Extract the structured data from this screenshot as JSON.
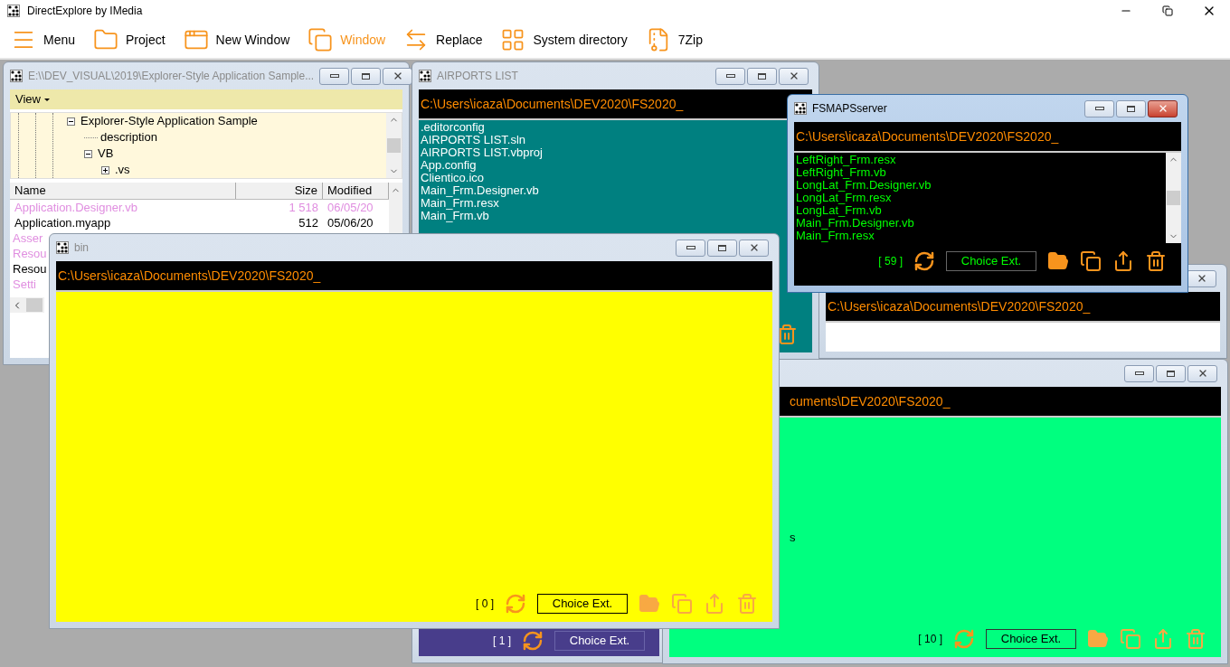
{
  "app": {
    "title": "DirectExplore by IMedia",
    "toolbar": [
      {
        "label": "Menu",
        "selected": false
      },
      {
        "label": "Project",
        "selected": false
      },
      {
        "label": "New Window",
        "selected": false
      },
      {
        "label": "Window",
        "selected": true
      },
      {
        "label": "Replace",
        "selected": false
      },
      {
        "label": "System directory",
        "selected": false
      },
      {
        "label": "7Zip",
        "selected": false
      }
    ]
  },
  "windows": [
    {
      "kind": "explorer",
      "title": "E:\\\\DEV_VISUAL\\2019\\Explorer-Style Application Sample...",
      "active": false,
      "view_menu": "View",
      "tree": [
        {
          "label": "Explorer-Style Application Sample",
          "expanded": true,
          "children": [
            {
              "label": "description"
            },
            {
              "label": "VB",
              "expanded": true,
              "children": [
                {
                  "label": ".vs",
                  "expanded": false
                }
              ]
            }
          ]
        }
      ],
      "columns": [
        "Name",
        "Size",
        "Modified"
      ],
      "rows": [
        {
          "name": "Application.Designer.vb",
          "size": "1 518",
          "modified": "06/05/20",
          "color": "#e08ee0"
        },
        {
          "name": "Application.myapp",
          "size": "512",
          "modified": "05/06/20",
          "color": "#000000"
        },
        {
          "name": "Asser",
          "color": "#e08ee0"
        },
        {
          "name": "Resou",
          "color": "#e08ee0"
        },
        {
          "name": "Resou",
          "color": "#000000"
        },
        {
          "name": "Setti",
          "color": "#e08ee0"
        }
      ]
    },
    {
      "kind": "folder",
      "title": "AIRPORTS LIST",
      "active": false,
      "path": "C:\\Users\\icaza\\Documents\\DEV2020\\FS2020_",
      "color": "#008080",
      "files": [
        ".editorconfig",
        "AIRPORTS LIST.sln",
        "AIRPORTS LIST.vbproj",
        "App.config",
        "Clientico.ico",
        "Main_Frm.Designer.vb",
        "Main_Frm.resx",
        "Main_Frm.vb"
      ]
    },
    {
      "kind": "folder",
      "color": "#483d8b",
      "counter": "[ 1 ]",
      "choice": "Choice Ext."
    },
    {
      "kind": "folder",
      "active": false,
      "path": "C:\\Users\\icaza\\Documents\\DEV2020\\FS2020_",
      "color": "#ffffff"
    },
    {
      "kind": "folder",
      "title": "FSMAPSserver",
      "active": true,
      "path": "C:\\Users\\icaza\\Documents\\DEV2020\\FS2020_",
      "color": "#000000",
      "files": [
        "LeftRight_Frm.resx",
        "LeftRight_Frm.vb",
        "LongLat_Frm.Designer.vb",
        "LongLat_Frm.resx",
        "LongLat_Frm.vb",
        "Main_Frm.Designer.vb",
        "Main_Frm.resx"
      ],
      "counter": "[ 59 ]",
      "choice": "Choice Ext."
    },
    {
      "kind": "folder",
      "active": false,
      "path": "cuments\\DEV2020\\FS2020_",
      "color": "#00ff7f",
      "files": [
        "s"
      ],
      "counter": "[ 10 ]",
      "choice": "Choice Ext."
    },
    {
      "kind": "folder",
      "title": "bin",
      "active": false,
      "path": "C:\\Users\\icaza\\Documents\\DEV2020\\FS2020_",
      "color": "#ffff00",
      "counter": "[ 0 ]",
      "choice": "Choice Ext."
    }
  ]
}
